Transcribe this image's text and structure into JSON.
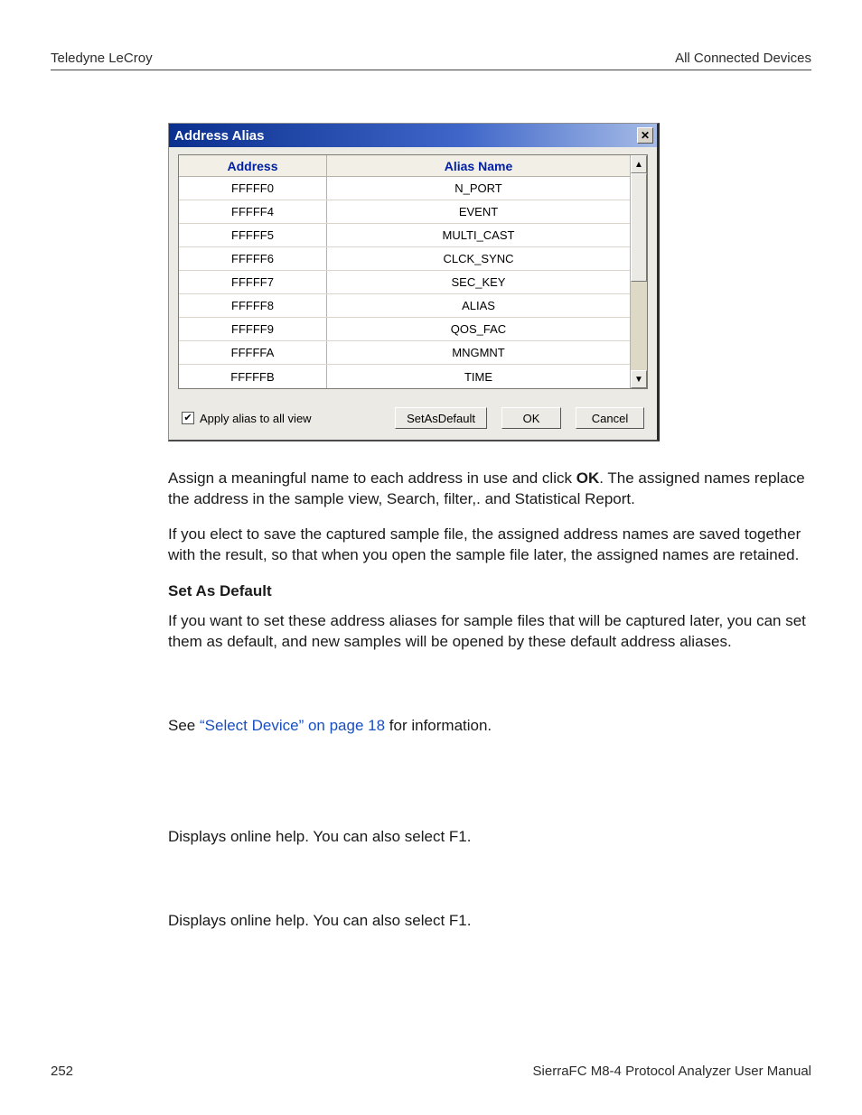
{
  "header": {
    "left": "Teledyne LeCroy",
    "right": "All Connected Devices"
  },
  "dialog": {
    "title": "Address Alias",
    "close_glyph": "✕",
    "columns": {
      "address": "Address",
      "alias": "Alias Name"
    },
    "rows": [
      {
        "address": "FFFFF0",
        "alias": "N_PORT"
      },
      {
        "address": "FFFFF4",
        "alias": "EVENT"
      },
      {
        "address": "FFFFF5",
        "alias": "MULTI_CAST"
      },
      {
        "address": "FFFFF6",
        "alias": "CLCK_SYNC"
      },
      {
        "address": "FFFFF7",
        "alias": "SEC_KEY"
      },
      {
        "address": "FFFFF8",
        "alias": "ALIAS"
      },
      {
        "address": "FFFFF9",
        "alias": "QOS_FAC"
      },
      {
        "address": "FFFFFA",
        "alias": "MNGMNT"
      },
      {
        "address": "FFFFFB",
        "alias": "TIME"
      }
    ],
    "apply_all_label": "Apply alias to all view",
    "apply_all_check": "✔",
    "btn_default": "SetAsDefault",
    "btn_ok": "OK",
    "btn_cancel": "Cancel",
    "scroll_up": "▲",
    "scroll_down": "▼"
  },
  "body": {
    "p1_a": "Assign a meaningful name to each address in use and click ",
    "p1_b": "OK",
    "p1_c": ". The assigned names replace the address in the sample view, Search, filter,. and Statistical Report.",
    "p2": "If you elect to save the captured sample file, the assigned address names are saved together with the result, so that when you open the sample file later, the assigned names are retained.",
    "h1": "Set As Default",
    "p3": "If you want to set these address aliases for sample files that will be captured later, you can set them as default, and new samples will be opened by these default address aliases.",
    "p4_a": "See ",
    "p4_link": "“Select Device” on page 18",
    "p4_b": " for information.",
    "p5": "Displays online help. You can also select F1.",
    "p6": "Displays online help. You can also select F1."
  },
  "footer": {
    "left": "252",
    "right": "SierraFC M8-4 Protocol Analyzer User Manual"
  }
}
